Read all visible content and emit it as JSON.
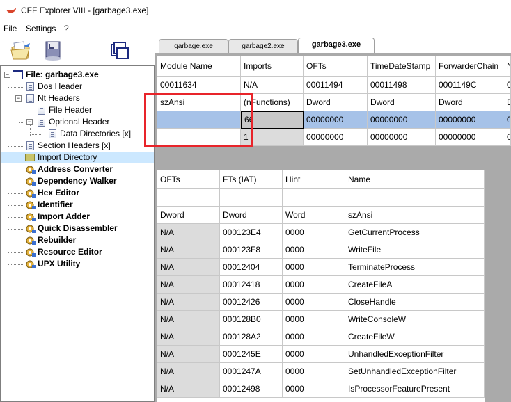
{
  "window": {
    "title": "CFF Explorer VIII - [garbage3.exe]"
  },
  "menu": {
    "items": [
      "File",
      "Settings",
      "?"
    ]
  },
  "tabs": [
    {
      "label": "garbage.exe",
      "active": false
    },
    {
      "label": "garbage2.exe",
      "active": false
    },
    {
      "label": "garbage3.exe",
      "active": true
    }
  ],
  "tree": {
    "root": "File: garbage3.exe",
    "dos_header": "Dos Header",
    "nt_headers": "Nt Headers",
    "file_header": "File Header",
    "optional_header": "Optional Header",
    "data_directories": "Data Directories [x]",
    "section_headers": "Section Headers [x]",
    "import_directory": "Import Directory",
    "tools": [
      "Address Converter",
      "Dependency Walker",
      "Hex Editor",
      "Identifier",
      "Import Adder",
      "Quick Disassembler",
      "Rebuilder",
      "Resource Editor",
      "UPX Utility"
    ]
  },
  "modules_table": {
    "columns": [
      "Module Name",
      "Imports",
      "OFTs",
      "TimeDateStamp",
      "ForwarderChain",
      "N"
    ],
    "values_row": [
      "00011634",
      "N/A",
      "00011494",
      "00011498",
      "0001149C",
      "0"
    ],
    "types_row": [
      "szAnsi",
      "(nFunctions)",
      "Dword",
      "Dword",
      "Dword",
      "D"
    ],
    "rows": [
      [
        "",
        "66",
        "00000000",
        "00000000",
        "00000000",
        "0"
      ],
      [
        "",
        "1",
        "00000000",
        "00000000",
        "00000000",
        "0"
      ]
    ]
  },
  "functions_table": {
    "columns": [
      "OFTs",
      "FTs (IAT)",
      "Hint",
      "Name"
    ],
    "types_row": [
      "Dword",
      "Dword",
      "Word",
      "szAnsi"
    ],
    "rows": [
      [
        "N/A",
        "000123E4",
        "0000",
        "GetCurrentProcess"
      ],
      [
        "N/A",
        "000123F8",
        "0000",
        "WriteFile"
      ],
      [
        "N/A",
        "00012404",
        "0000",
        "TerminateProcess"
      ],
      [
        "N/A",
        "00012418",
        "0000",
        "CreateFileA"
      ],
      [
        "N/A",
        "00012426",
        "0000",
        "CloseHandle"
      ],
      [
        "N/A",
        "000128B0",
        "0000",
        "WriteConsoleW"
      ],
      [
        "N/A",
        "000128A2",
        "0000",
        "CreateFileW"
      ],
      [
        "N/A",
        "0001245E",
        "0000",
        "UnhandledExceptionFilter"
      ],
      [
        "N/A",
        "0001247A",
        "0000",
        "SetUnhandledExceptionFilter"
      ],
      [
        "N/A",
        "00012498",
        "0000",
        "IsProcessorFeaturePresent"
      ]
    ]
  },
  "icons": {
    "app": "cff-explorer-icon",
    "toolbar": [
      "open-file-icon",
      "save-file-icon",
      "windows-icon"
    ]
  },
  "colors": {
    "highlight_box": "#e8242a",
    "selection": "#a6c2e8",
    "tree_selected": "#cce8ff"
  }
}
